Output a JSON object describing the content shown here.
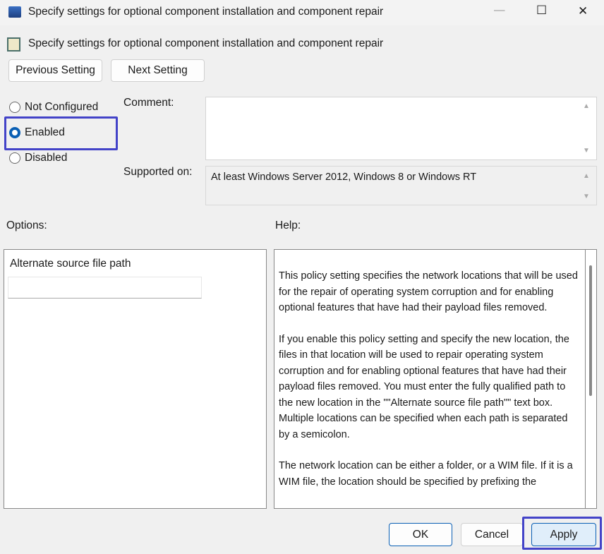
{
  "window": {
    "title": "Specify settings for optional component installation and component repair",
    "minimize": "—",
    "maximize": "☐",
    "close": "✕"
  },
  "header": {
    "title": "Specify settings for optional component installation and component repair"
  },
  "nav": {
    "previous": "Previous Setting",
    "next": "Next Setting"
  },
  "state": {
    "options": [
      "Not Configured",
      "Enabled",
      "Disabled"
    ],
    "selected": "Enabled"
  },
  "comment": {
    "label": "Comment:",
    "value": ""
  },
  "supported": {
    "label": "Supported on:",
    "value": "At least Windows Server 2012, Windows 8 or Windows RT"
  },
  "options": {
    "label": "Options:",
    "field_label": "Alternate source file path",
    "field_value": ""
  },
  "help": {
    "label": "Help:",
    "paragraphs": [
      "This policy setting specifies the network locations that will be used for the repair of operating system corruption and for enabling optional features that have had their payload files removed.",
      "If you enable this policy setting and specify the new location, the files in that location will be used to repair operating system corruption and for enabling optional features that have had their payload files removed. You must enter the fully qualified path to the new location in the \"\"Alternate source file path\"\" text box. Multiple locations can be specified when each path is separated by a semicolon.",
      "The network location can be either a folder, or a WIM file. If it is a WIM file, the location should be specified by prefixing the"
    ]
  },
  "footer": {
    "ok": "OK",
    "cancel": "Cancel",
    "apply": "Apply"
  },
  "colors": {
    "accent": "#0a5fb4",
    "highlight": "#4343c8"
  }
}
